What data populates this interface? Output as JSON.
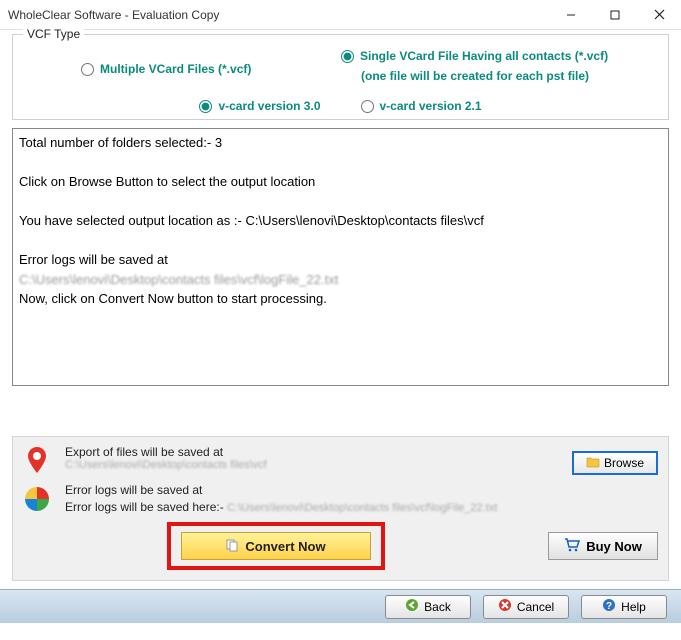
{
  "title": "WholeClear Software - Evaluation Copy",
  "vcf": {
    "legend": "VCF Type",
    "multi": "Multiple VCard Files (*.vcf)",
    "single": "Single VCard File Having all contacts (*.vcf)",
    "single_sub": "(one file will be created for each pst file)",
    "v30": "v-card version 3.0",
    "v21": "v-card version 2.1"
  },
  "log": {
    "l1": "Total number of folders selected:- 3",
    "l2": "Click on Browse Button to select the output location",
    "l3": "You have selected output location as :- C:\\Users\\lenovi\\Desktop\\contacts files\\vcf",
    "l4": "Error logs will be saved at",
    "l5": "C:\\Users\\lenovi\\Desktop\\contacts files\\vcf\\logFile_22.txt",
    "l6": "Now, click on Convert Now button to start processing."
  },
  "export": {
    "label": "Export of files will be saved at",
    "path": "C:\\Users\\lenovi\\Desktop\\contacts files\\vcf",
    "browse": "Browse"
  },
  "errlog": {
    "label": "Error logs will be saved at",
    "line2": "Error logs will be saved here:- C:\\Users\\lenovi\\Desktop\\contacts files\\vcf\\logFile_22.txt"
  },
  "buttons": {
    "convert": "Convert Now",
    "buy": "Buy Now",
    "back": "Back",
    "cancel": "Cancel",
    "help": "Help"
  }
}
